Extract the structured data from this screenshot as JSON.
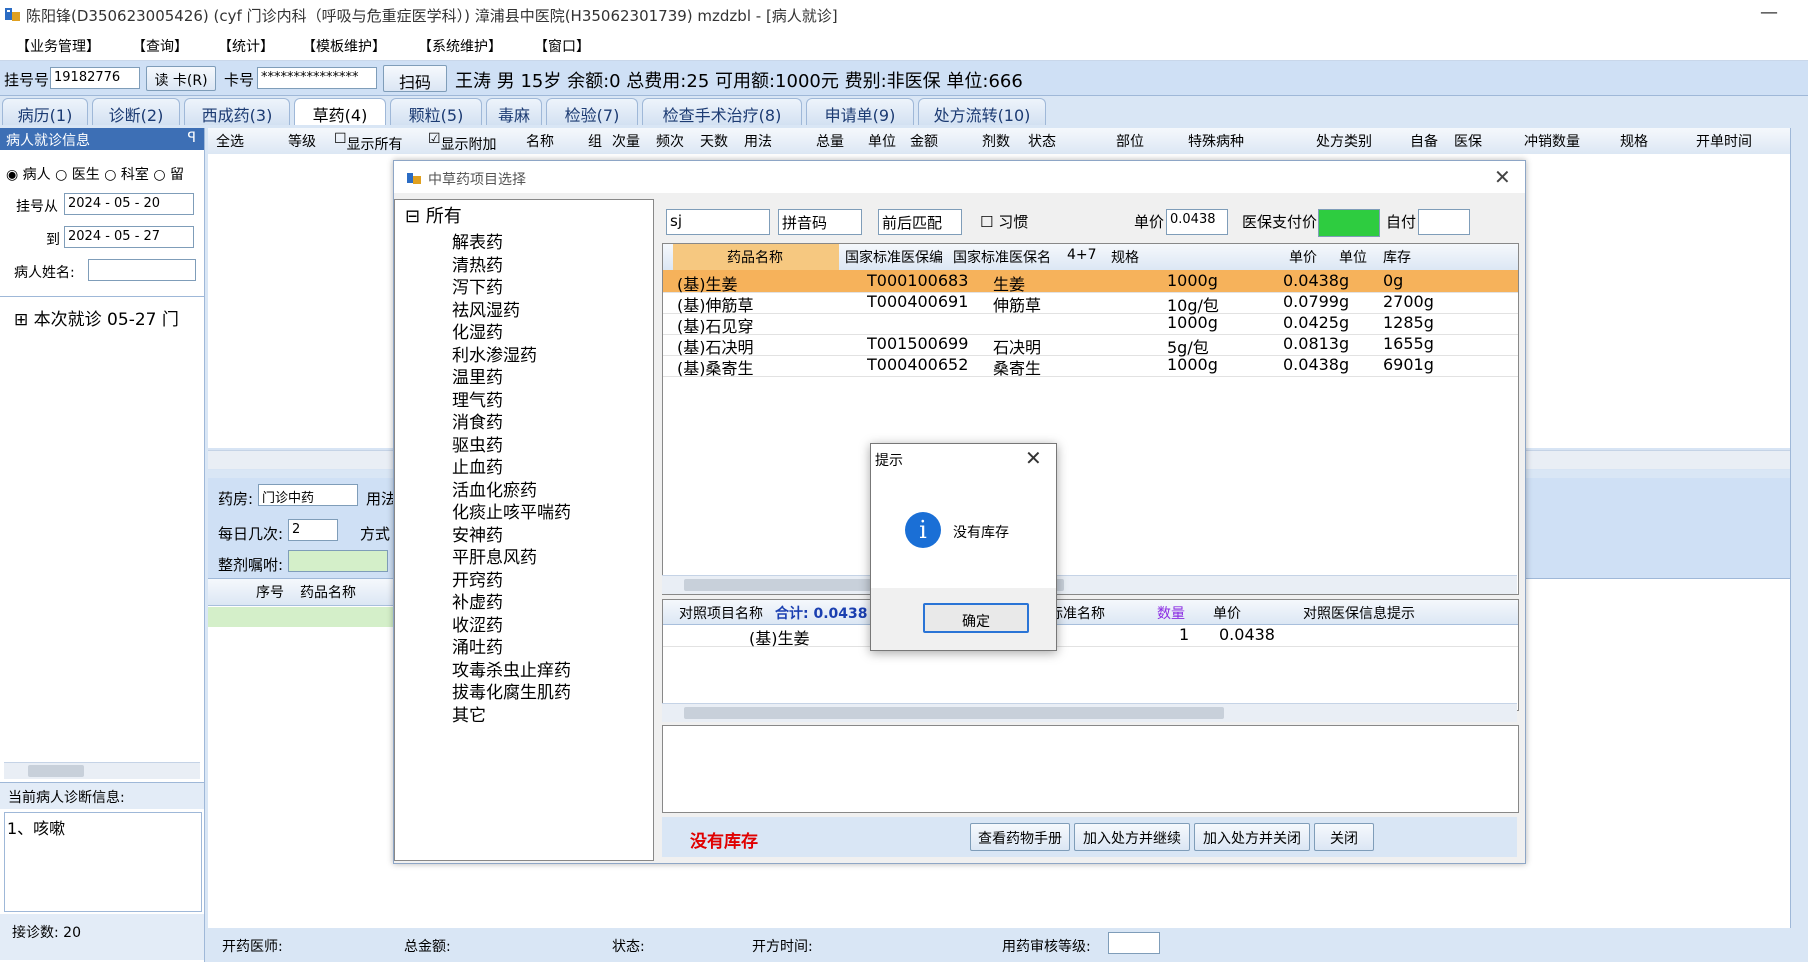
{
  "window": {
    "title": "陈阳锋(D350623005426) (cyf 门诊内科（呼吸与危重症医学科）) 漳浦县中医院(H35062301739) mzdzbl - [病人就诊]",
    "minimize": "—"
  },
  "menu": [
    "【业务管理】",
    "【查询】",
    "【统计】",
    "【模板维护】",
    "【系统维护】",
    "【窗口】"
  ],
  "patient_bar": {
    "reg_label": "挂号号",
    "reg_value": "19182776",
    "read_card": "读 卡(R)",
    "card_label": "卡号",
    "card_value": "***************",
    "scan": "扫码",
    "info": "王涛  男  15岁  余额:0 总费用:25  可用额:1000元  费别:非医保  单位:666"
  },
  "tabs": [
    "病历(1)",
    "诊断(2)",
    "西成药(3)",
    "草药(4)",
    "颗粒(5)",
    "毒麻",
    "检验(7)",
    "检查手术治疗(8)",
    "申请单(9)",
    "处方流转(10)"
  ],
  "left": {
    "header": "病人就诊信息",
    "pin": "ꟼ",
    "radios": [
      "病人",
      "医生",
      "科室",
      "留"
    ],
    "reg_from_label": "挂号从",
    "reg_from": "2024 - 05 - 20",
    "to_label": "到",
    "to": "2024 - 05 - 27",
    "name_label": "病人姓名:",
    "visit_node": "本次就诊  05-27  门",
    "diag_label": "当前病人诊断信息:",
    "diag_text": "1、咳嗽",
    "count": "接诊数: 20"
  },
  "main_grid": {
    "headers": [
      "全选",
      "等级",
      "显示所有",
      "显示附加",
      "名称",
      "组",
      "次量",
      "频次",
      "天数",
      "用法",
      "总量",
      "单位",
      "金额",
      "剂数",
      "状态",
      "部位",
      "特殊病种",
      "处方类别",
      "自备",
      "医保",
      "冲销数量",
      "规格",
      "开单时间"
    ]
  },
  "lower": {
    "pharmacy_label": "药房:",
    "pharmacy_value": "门诊中药",
    "usage_label": "用法",
    "daily_label": "每日几次:",
    "daily_value": "2",
    "method_label": "方式",
    "note_label": "整剂嘱咐:",
    "grid_headers": [
      "序号",
      "药品名称"
    ]
  },
  "footer": {
    "doctor": "开药医师:",
    "total": "总金额:",
    "status": "状态:",
    "time": "开方时间:",
    "review": "用药审核等级:"
  },
  "dialog": {
    "title": "中草药项目选择",
    "tree_root": "所有",
    "tree_items": [
      "解表药",
      "清热药",
      "泻下药",
      "祛风湿药",
      "化湿药",
      "利水渗湿药",
      "温里药",
      "理气药",
      "消食药",
      "驱虫药",
      "止血药",
      "活血化瘀药",
      "化痰止咳平喘药",
      "安神药",
      "平肝息风药",
      "开窍药",
      "补虚药",
      "收涩药",
      "涌吐药",
      "攻毒杀虫止痒药",
      "拔毒化腐生肌药",
      "其它"
    ],
    "search_value": "sj",
    "search_mode": "拼音码",
    "match_mode": "前后匹配",
    "habit": "习惯",
    "price_label": "单价",
    "price_value": "0.0438",
    "insurance_label": "医保支付价",
    "self_label": "自付",
    "table_headers": [
      "药品名称",
      "国家标准医保编",
      "国家标准医保名",
      "4+7",
      "规格",
      "单价",
      "单位",
      "库存"
    ],
    "rows": [
      [
        "(基)生姜",
        "T000100683",
        "生姜",
        "",
        "1000g",
        "0.0438",
        "g",
        "0g"
      ],
      [
        "(基)伸筋草",
        "T000400691",
        "伸筋草",
        "",
        "10g/包",
        "0.0799",
        "g",
        "2700g"
      ],
      [
        "(基)石见穿",
        "",
        "",
        "",
        "1000g",
        "0.0425",
        "g",
        "1285g"
      ],
      [
        "(基)石决明",
        "T001500699",
        "石决明",
        "",
        "5g/包",
        "0.0813",
        "g",
        "1655g"
      ],
      [
        "(基)桑寄生",
        "T000400652",
        "桑寄生",
        "",
        "1000g",
        "0.0438",
        "g",
        "6901g"
      ]
    ],
    "sub_headers": {
      "name": "对照项目名称",
      "total": "合计: 0.0438",
      "std_name": "国家标准名称",
      "qty": "数量",
      "unit_price": "单价",
      "hint": "对照医保信息提示"
    },
    "sub_row": {
      "name": "(基)生姜",
      "std_name": "生姜",
      "qty": "1",
      "price": "0.0438"
    },
    "stock_msg": "没有库存",
    "buttons": [
      "查看药物手册",
      "加入处方并继续",
      "加入处方并关闭",
      "关闭"
    ]
  },
  "msgbox": {
    "title": "提示",
    "text": "没有库存",
    "ok": "确定"
  },
  "colors": {
    "accent": "#3d6fb5",
    "highlight_row": "#f6b25b",
    "insurance_green": "#2ecc40",
    "warning_red": "#e00000"
  }
}
